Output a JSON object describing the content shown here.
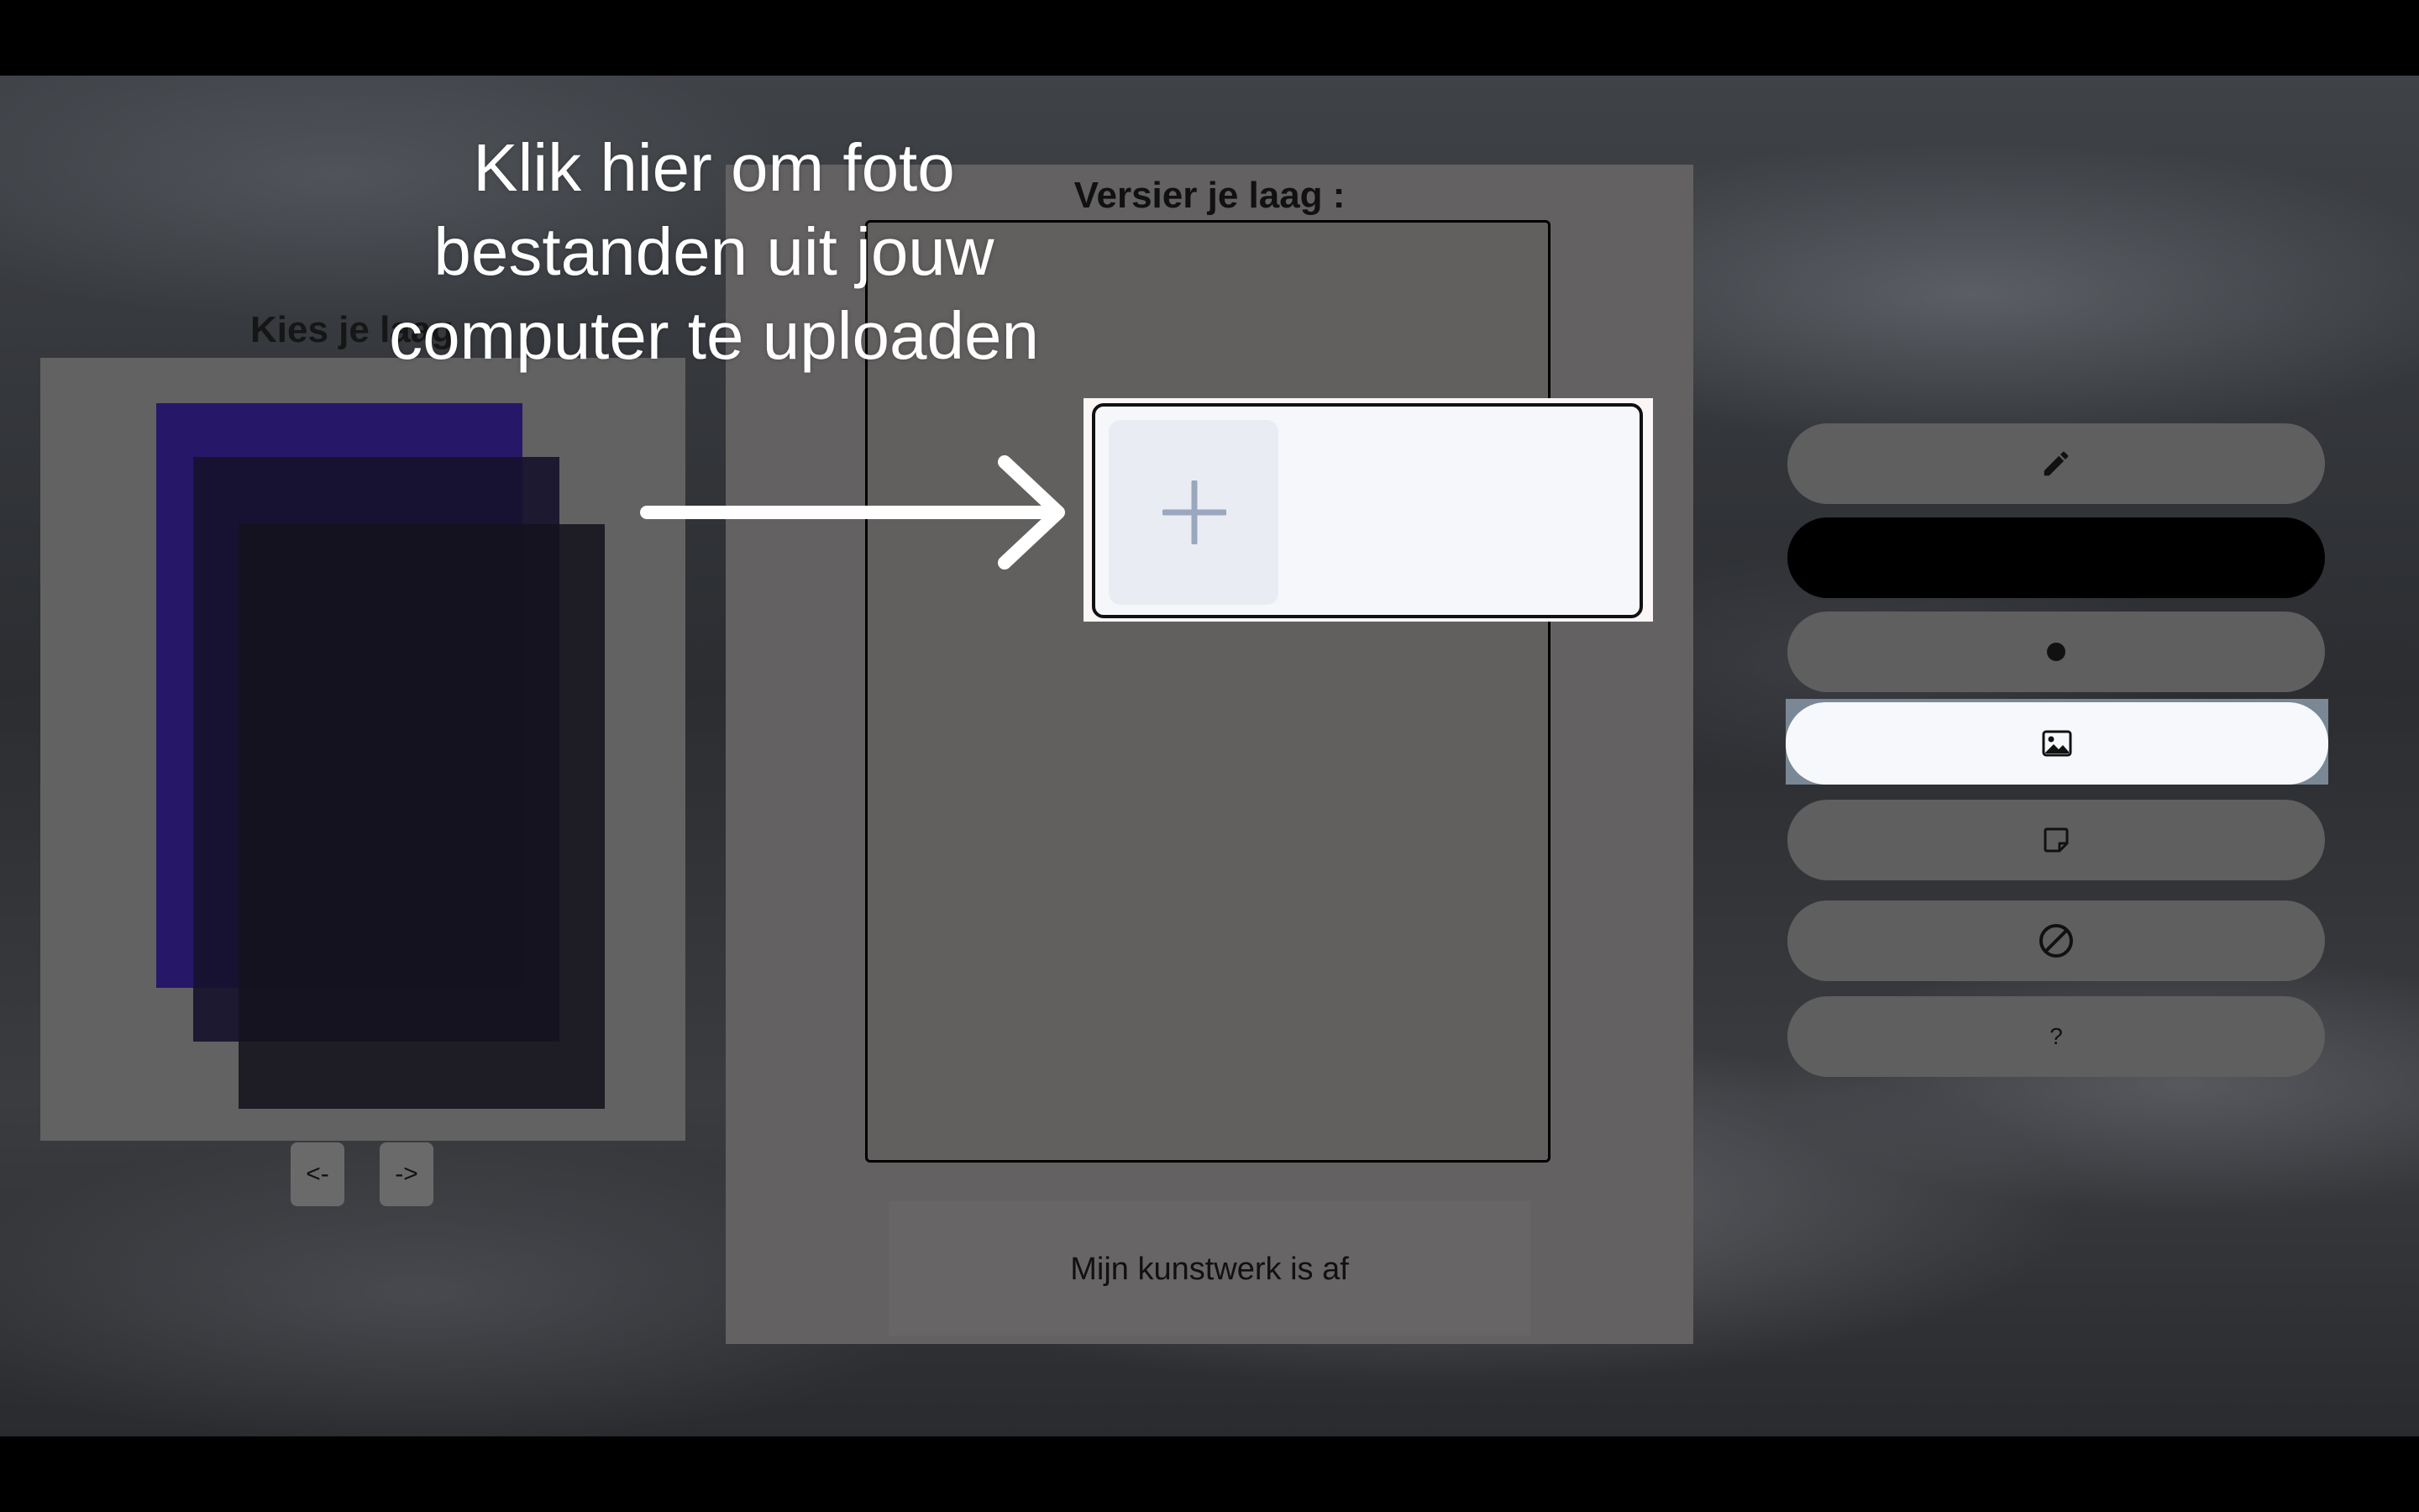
{
  "layers_panel": {
    "title": "Kies je laag",
    "prev_label": "<-",
    "next_label": "->"
  },
  "decorate_panel": {
    "title": "Versier je laag :",
    "finish_label": "Mijn kunstwerk is af"
  },
  "tools": [
    {
      "name": "pencil",
      "icon": "pencil-icon"
    },
    {
      "name": "color",
      "icon": "none",
      "color": "#000000"
    },
    {
      "name": "brush-size",
      "icon": "dot-icon"
    },
    {
      "name": "image-upload",
      "icon": "image-icon",
      "active": true
    },
    {
      "name": "sticky-note",
      "icon": "note-icon"
    },
    {
      "name": "clear",
      "icon": "prohibited-icon"
    },
    {
      "name": "help",
      "label": "?"
    }
  ],
  "upload": {
    "icon": "plus-icon"
  },
  "tutorial": {
    "text": "Klik hier om foto\nbestanden uit jouw\ncomputer te uploaden"
  },
  "colors": {
    "layer_1": "#271768",
    "upload_plus": "#9aa7bf"
  }
}
